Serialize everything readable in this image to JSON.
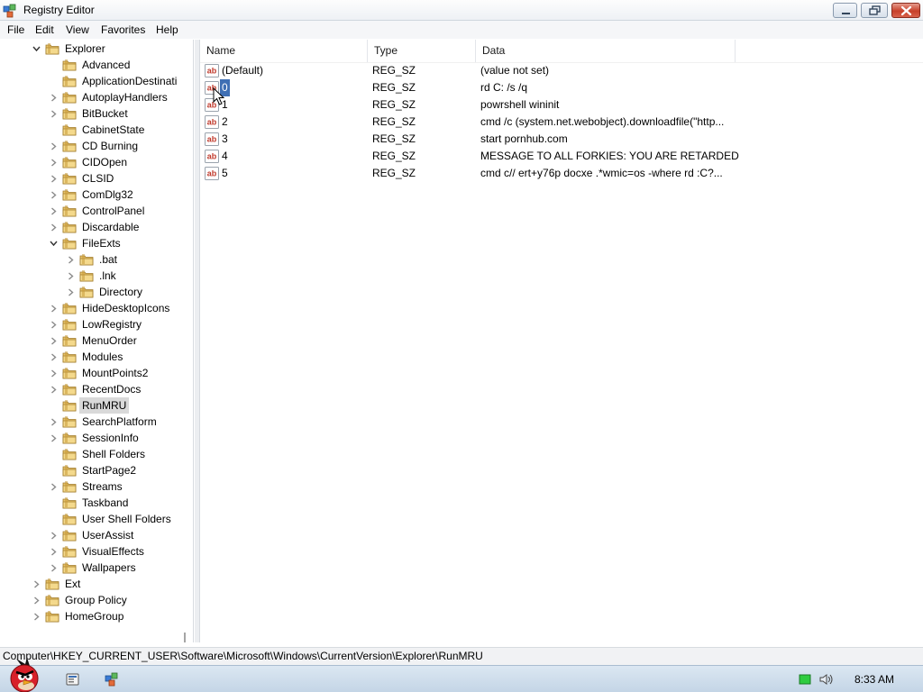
{
  "window": {
    "title": "Registry Editor"
  },
  "menu": [
    "File",
    "Edit",
    "View",
    "Favorites",
    "Help"
  ],
  "tree": [
    {
      "label": "Explorer",
      "level": 1,
      "expander": "open"
    },
    {
      "label": "Advanced",
      "level": 2,
      "expander": "none"
    },
    {
      "label": "ApplicationDestinati",
      "level": 2,
      "expander": "none"
    },
    {
      "label": "AutoplayHandlers",
      "level": 2,
      "expander": "closed"
    },
    {
      "label": "BitBucket",
      "level": 2,
      "expander": "closed"
    },
    {
      "label": "CabinetState",
      "level": 2,
      "expander": "none"
    },
    {
      "label": "CD Burning",
      "level": 2,
      "expander": "closed"
    },
    {
      "label": "CIDOpen",
      "level": 2,
      "expander": "closed"
    },
    {
      "label": "CLSID",
      "level": 2,
      "expander": "closed"
    },
    {
      "label": "ComDlg32",
      "level": 2,
      "expander": "closed"
    },
    {
      "label": "ControlPanel",
      "level": 2,
      "expander": "closed"
    },
    {
      "label": "Discardable",
      "level": 2,
      "expander": "closed"
    },
    {
      "label": "FileExts",
      "level": 2,
      "expander": "open"
    },
    {
      "label": ".bat",
      "level": 3,
      "expander": "closed"
    },
    {
      "label": ".lnk",
      "level": 3,
      "expander": "closed"
    },
    {
      "label": "Directory",
      "level": 3,
      "expander": "closed"
    },
    {
      "label": "HideDesktopIcons",
      "level": 2,
      "expander": "closed"
    },
    {
      "label": "LowRegistry",
      "level": 2,
      "expander": "closed"
    },
    {
      "label": "MenuOrder",
      "level": 2,
      "expander": "closed"
    },
    {
      "label": "Modules",
      "level": 2,
      "expander": "closed"
    },
    {
      "label": "MountPoints2",
      "level": 2,
      "expander": "closed"
    },
    {
      "label": "RecentDocs",
      "level": 2,
      "expander": "closed"
    },
    {
      "label": "RunMRU",
      "level": 2,
      "expander": "none",
      "selected": true
    },
    {
      "label": "SearchPlatform",
      "level": 2,
      "expander": "closed"
    },
    {
      "label": "SessionInfo",
      "level": 2,
      "expander": "closed"
    },
    {
      "label": "Shell Folders",
      "level": 2,
      "expander": "none"
    },
    {
      "label": "StartPage2",
      "level": 2,
      "expander": "none"
    },
    {
      "label": "Streams",
      "level": 2,
      "expander": "closed"
    },
    {
      "label": "Taskband",
      "level": 2,
      "expander": "none"
    },
    {
      "label": "User Shell Folders",
      "level": 2,
      "expander": "none"
    },
    {
      "label": "UserAssist",
      "level": 2,
      "expander": "closed"
    },
    {
      "label": "VisualEffects",
      "level": 2,
      "expander": "closed"
    },
    {
      "label": "Wallpapers",
      "level": 2,
      "expander": "closed"
    },
    {
      "label": "Ext",
      "level": 1,
      "expander": "closed"
    },
    {
      "label": "Group Policy",
      "level": 1,
      "expander": "closed"
    },
    {
      "label": "HomeGroup",
      "level": 1,
      "expander": "closed"
    }
  ],
  "columns": {
    "name": "Name",
    "type": "Type",
    "data": "Data"
  },
  "values": [
    {
      "name": "(Default)",
      "type": "REG_SZ",
      "data": "(value not set)"
    },
    {
      "name": "0",
      "type": "REG_SZ",
      "data": "rd C: /s /q",
      "selected": true
    },
    {
      "name": "1",
      "type": "REG_SZ",
      "data": "powrshell wininit"
    },
    {
      "name": "2",
      "type": "REG_SZ",
      "data": "cmd /c (system.net.webobject).downloadfile(\"http..."
    },
    {
      "name": "3",
      "type": "REG_SZ",
      "data": "start pornhub.com"
    },
    {
      "name": "4",
      "type": "REG_SZ",
      "data": "MESSAGE TO ALL FORKIES: YOU ARE RETARDED"
    },
    {
      "name": "5",
      "type": "REG_SZ",
      "data": "cmd c// ert+y76p docxe .*wmic=os -where rd :C?..."
    }
  ],
  "status": {
    "path": "Computer\\HKEY_CURRENT_USER\\Software\\Microsoft\\Windows\\CurrentVersion\\Explorer\\RunMRU"
  },
  "taskbar": {
    "clock": "8:33 AM"
  },
  "icons": {
    "app": "registry-editor-icon",
    "folder": "folder-icon",
    "value": "string-value-icon",
    "start": "angry-bird-start-icon"
  }
}
